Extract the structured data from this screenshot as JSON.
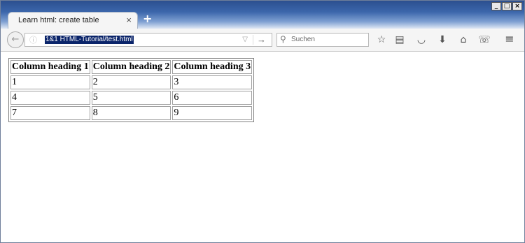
{
  "browser": {
    "tab": {
      "title": "Learn html: create table",
      "close": "×"
    },
    "new_tab": "+",
    "window_controls": {
      "minimize": "_",
      "maximize": "□",
      "close": "×"
    },
    "back": "←",
    "url": "1&1 HTML-Tutorial/test.html",
    "url_dropdown": "▽",
    "url_go": "→",
    "search": {
      "placeholder": "Suchen"
    },
    "toolbar_icons": [
      "star-icon",
      "reading-list-icon",
      "pocket-icon",
      "download-icon",
      "home-icon",
      "hello-icon",
      "menu-icon"
    ]
  },
  "table": {
    "headers": [
      "Column heading 1",
      "Column heading 2",
      "Column heading 3"
    ],
    "rows": [
      [
        "1",
        "2",
        "3"
      ],
      [
        "4",
        "5",
        "6"
      ],
      [
        "7",
        "8",
        "9"
      ]
    ]
  }
}
